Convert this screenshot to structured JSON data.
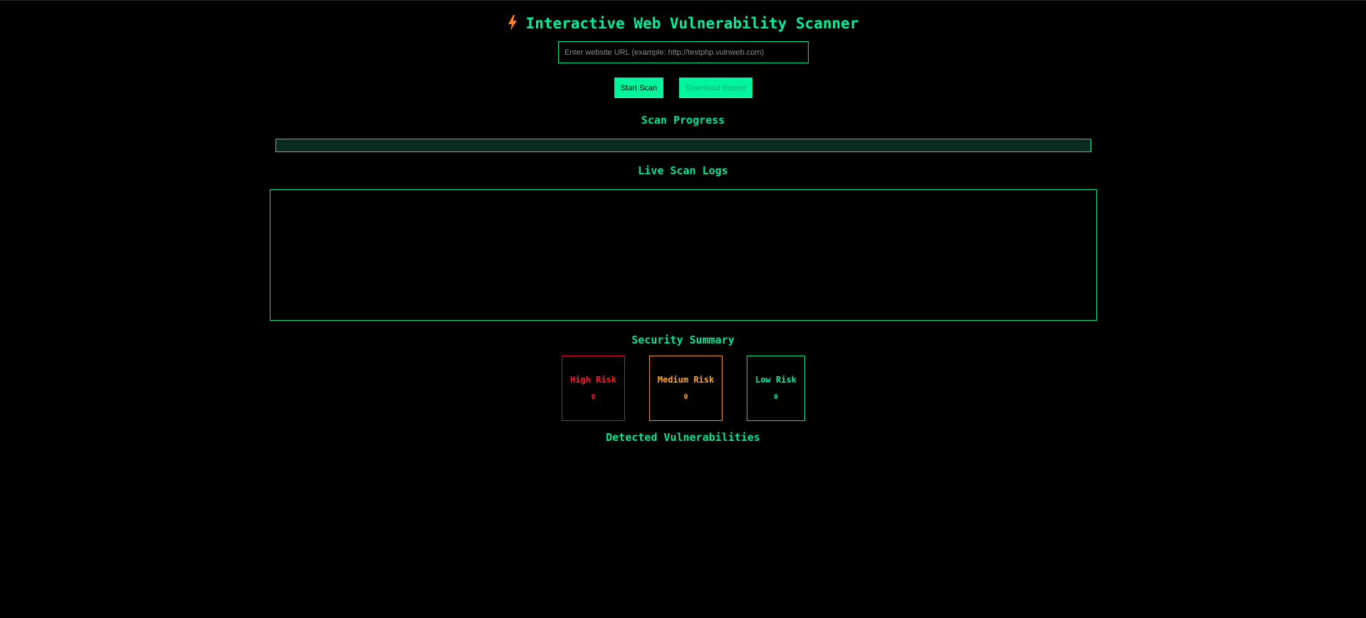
{
  "header": {
    "title": "Interactive Web Vulnerability Scanner",
    "icon": "lightning-bolt-icon",
    "icon_color": "#ff7a2a"
  },
  "url_input": {
    "value": "",
    "placeholder": "Enter website URL (example: http://testphp.vulnweb.com)"
  },
  "buttons": {
    "start_label": "Start Scan",
    "download_label": "Download Report"
  },
  "progress": {
    "heading": "Scan Progress",
    "percent": 0
  },
  "logs": {
    "heading": "Live Scan Logs",
    "entries": []
  },
  "summary": {
    "heading": "Security Summary",
    "high": {
      "label": "High Risk",
      "count": "0",
      "color": "#ff1a2a"
    },
    "medium": {
      "label": "Medium Risk",
      "count": "0",
      "color": "#ffa42a"
    },
    "low": {
      "label": "Low Risk",
      "count": "0",
      "color": "#00f0a0"
    }
  },
  "vulnerabilities": {
    "heading": "Detected Vulnerabilities",
    "items": []
  },
  "theme": {
    "accent": "#00f59c",
    "background": "#000000"
  }
}
